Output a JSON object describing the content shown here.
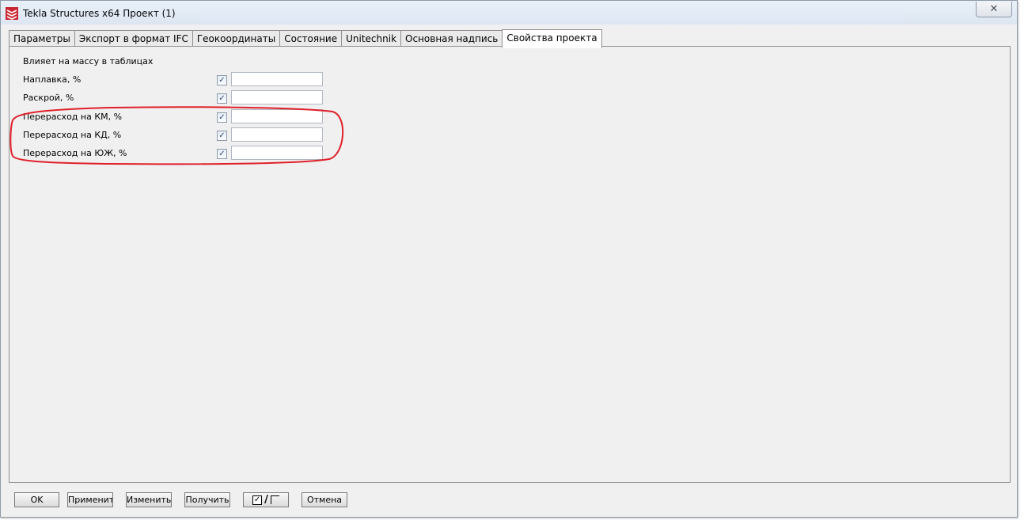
{
  "window": {
    "title": "Tekla Structures x64  Проект (1)",
    "close_glyph": "✕"
  },
  "tabs": [
    {
      "label": "Параметры",
      "active": false
    },
    {
      "label": "Экспорт в формат IFC",
      "active": false
    },
    {
      "label": "Геокоординаты",
      "active": false
    },
    {
      "label": "Состояние",
      "active": false
    },
    {
      "label": "Unitechnik",
      "active": false
    },
    {
      "label": "Основная надпись",
      "active": false
    },
    {
      "label": "Свойства проекта",
      "active": true
    }
  ],
  "panel": {
    "section_label": "Влияет на массу в таблицах",
    "rows": [
      {
        "label": "Наплавка, %",
        "checked": true,
        "value": ""
      },
      {
        "label": "Раскрой, %",
        "checked": true,
        "value": ""
      },
      {
        "label": "Перерасход на КМ, %",
        "checked": true,
        "value": ""
      },
      {
        "label": "Перерасход на КД, %",
        "checked": true,
        "value": ""
      },
      {
        "label": "Перерасход на ЮЖ, %",
        "checked": true,
        "value": ""
      }
    ],
    "annotation_color": "#e0202a"
  },
  "buttons": {
    "ok": "OK",
    "apply": "Применить",
    "modify": "Изменить",
    "get": "Получить",
    "toggle_checked": "✓",
    "toggle_slash": "/",
    "cancel": "Отмена"
  },
  "icons": {
    "app": "tekla-logo-icon",
    "checkbox_mark": "✓"
  }
}
